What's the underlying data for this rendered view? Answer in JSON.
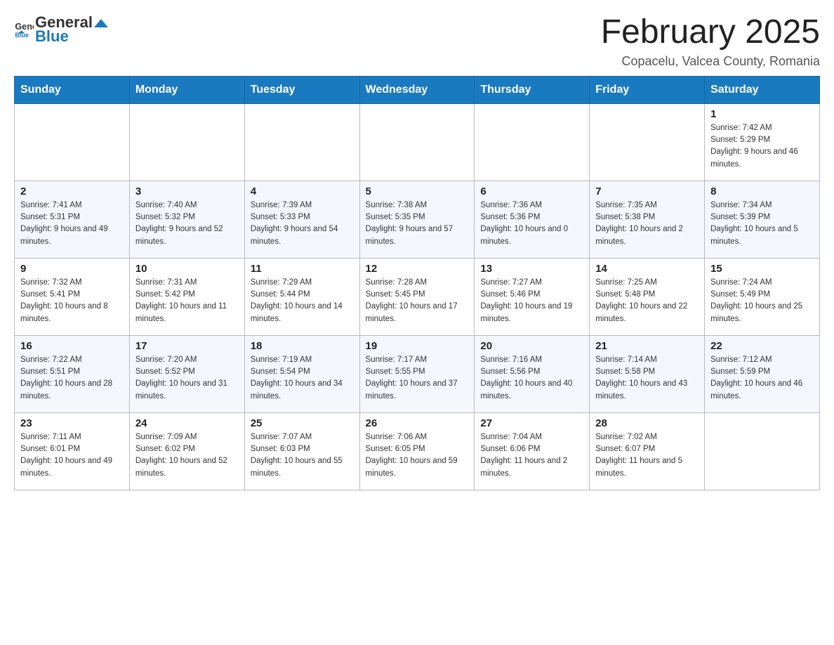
{
  "header": {
    "logo_general": "General",
    "logo_blue": "Blue",
    "month_title": "February 2025",
    "location": "Copacelu, Valcea County, Romania"
  },
  "days_of_week": [
    "Sunday",
    "Monday",
    "Tuesday",
    "Wednesday",
    "Thursday",
    "Friday",
    "Saturday"
  ],
  "weeks": [
    [
      {
        "day": "",
        "info": ""
      },
      {
        "day": "",
        "info": ""
      },
      {
        "day": "",
        "info": ""
      },
      {
        "day": "",
        "info": ""
      },
      {
        "day": "",
        "info": ""
      },
      {
        "day": "",
        "info": ""
      },
      {
        "day": "1",
        "info": "Sunrise: 7:42 AM\nSunset: 5:29 PM\nDaylight: 9 hours and 46 minutes."
      }
    ],
    [
      {
        "day": "2",
        "info": "Sunrise: 7:41 AM\nSunset: 5:31 PM\nDaylight: 9 hours and 49 minutes."
      },
      {
        "day": "3",
        "info": "Sunrise: 7:40 AM\nSunset: 5:32 PM\nDaylight: 9 hours and 52 minutes."
      },
      {
        "day": "4",
        "info": "Sunrise: 7:39 AM\nSunset: 5:33 PM\nDaylight: 9 hours and 54 minutes."
      },
      {
        "day": "5",
        "info": "Sunrise: 7:38 AM\nSunset: 5:35 PM\nDaylight: 9 hours and 57 minutes."
      },
      {
        "day": "6",
        "info": "Sunrise: 7:36 AM\nSunset: 5:36 PM\nDaylight: 10 hours and 0 minutes."
      },
      {
        "day": "7",
        "info": "Sunrise: 7:35 AM\nSunset: 5:38 PM\nDaylight: 10 hours and 2 minutes."
      },
      {
        "day": "8",
        "info": "Sunrise: 7:34 AM\nSunset: 5:39 PM\nDaylight: 10 hours and 5 minutes."
      }
    ],
    [
      {
        "day": "9",
        "info": "Sunrise: 7:32 AM\nSunset: 5:41 PM\nDaylight: 10 hours and 8 minutes."
      },
      {
        "day": "10",
        "info": "Sunrise: 7:31 AM\nSunset: 5:42 PM\nDaylight: 10 hours and 11 minutes."
      },
      {
        "day": "11",
        "info": "Sunrise: 7:29 AM\nSunset: 5:44 PM\nDaylight: 10 hours and 14 minutes."
      },
      {
        "day": "12",
        "info": "Sunrise: 7:28 AM\nSunset: 5:45 PM\nDaylight: 10 hours and 17 minutes."
      },
      {
        "day": "13",
        "info": "Sunrise: 7:27 AM\nSunset: 5:46 PM\nDaylight: 10 hours and 19 minutes."
      },
      {
        "day": "14",
        "info": "Sunrise: 7:25 AM\nSunset: 5:48 PM\nDaylight: 10 hours and 22 minutes."
      },
      {
        "day": "15",
        "info": "Sunrise: 7:24 AM\nSunset: 5:49 PM\nDaylight: 10 hours and 25 minutes."
      }
    ],
    [
      {
        "day": "16",
        "info": "Sunrise: 7:22 AM\nSunset: 5:51 PM\nDaylight: 10 hours and 28 minutes."
      },
      {
        "day": "17",
        "info": "Sunrise: 7:20 AM\nSunset: 5:52 PM\nDaylight: 10 hours and 31 minutes."
      },
      {
        "day": "18",
        "info": "Sunrise: 7:19 AM\nSunset: 5:54 PM\nDaylight: 10 hours and 34 minutes."
      },
      {
        "day": "19",
        "info": "Sunrise: 7:17 AM\nSunset: 5:55 PM\nDaylight: 10 hours and 37 minutes."
      },
      {
        "day": "20",
        "info": "Sunrise: 7:16 AM\nSunset: 5:56 PM\nDaylight: 10 hours and 40 minutes."
      },
      {
        "day": "21",
        "info": "Sunrise: 7:14 AM\nSunset: 5:58 PM\nDaylight: 10 hours and 43 minutes."
      },
      {
        "day": "22",
        "info": "Sunrise: 7:12 AM\nSunset: 5:59 PM\nDaylight: 10 hours and 46 minutes."
      }
    ],
    [
      {
        "day": "23",
        "info": "Sunrise: 7:11 AM\nSunset: 6:01 PM\nDaylight: 10 hours and 49 minutes."
      },
      {
        "day": "24",
        "info": "Sunrise: 7:09 AM\nSunset: 6:02 PM\nDaylight: 10 hours and 52 minutes."
      },
      {
        "day": "25",
        "info": "Sunrise: 7:07 AM\nSunset: 6:03 PM\nDaylight: 10 hours and 55 minutes."
      },
      {
        "day": "26",
        "info": "Sunrise: 7:06 AM\nSunset: 6:05 PM\nDaylight: 10 hours and 59 minutes."
      },
      {
        "day": "27",
        "info": "Sunrise: 7:04 AM\nSunset: 6:06 PM\nDaylight: 11 hours and 2 minutes."
      },
      {
        "day": "28",
        "info": "Sunrise: 7:02 AM\nSunset: 6:07 PM\nDaylight: 11 hours and 5 minutes."
      },
      {
        "day": "",
        "info": ""
      }
    ]
  ]
}
